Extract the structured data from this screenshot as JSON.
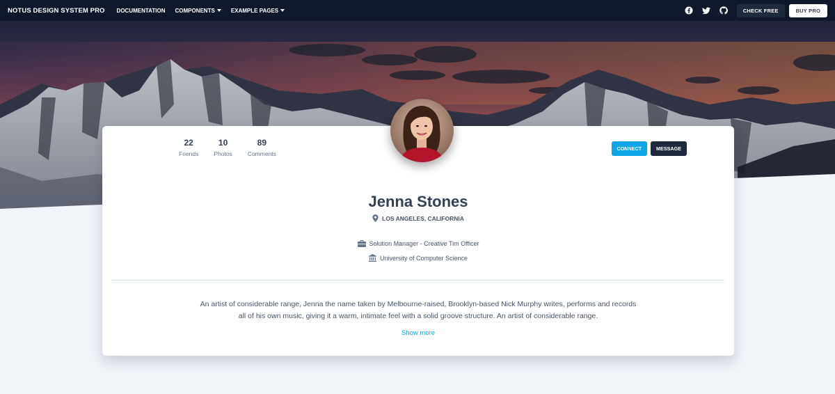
{
  "navbar": {
    "brand": "NOTUS DESIGN SYSTEM PRO",
    "links": [
      {
        "label": "DOCUMENTATION",
        "dropdown": false
      },
      {
        "label": "COMPONENTS",
        "dropdown": true
      },
      {
        "label": "EXAMPLE PAGES",
        "dropdown": true
      }
    ],
    "social_icons": [
      "facebook-icon",
      "twitter-icon",
      "github-icon"
    ],
    "check_free_label": "CHECK FREE",
    "buy_pro_label": "BUY PRO"
  },
  "profile": {
    "stats": [
      {
        "value": "22",
        "label": "Friends"
      },
      {
        "value": "10",
        "label": "Photos"
      },
      {
        "value": "89",
        "label": "Comments"
      }
    ],
    "connect_label": "CONNECT",
    "message_label": "MESSAGE",
    "name": "Jenna Stones",
    "location": "LOS ANGELES, CALIFORNIA",
    "job": "Solution Manager - Creative Tim Officer",
    "education": "University of Computer Science",
    "bio": "An artist of considerable range, Jenna the name taken by Melbourne-raised, Brooklyn-based Nick Murphy writes, performs and records all of his own music, giving it a warm, intimate feel with a solid groove structure. An artist of considerable range.",
    "show_more_label": "Show more"
  },
  "colors": {
    "navbar_bg": "#0f172a",
    "accent": "#0ea5e9",
    "dark_button": "#1e293b",
    "page_bg": "#f1f5f9"
  }
}
